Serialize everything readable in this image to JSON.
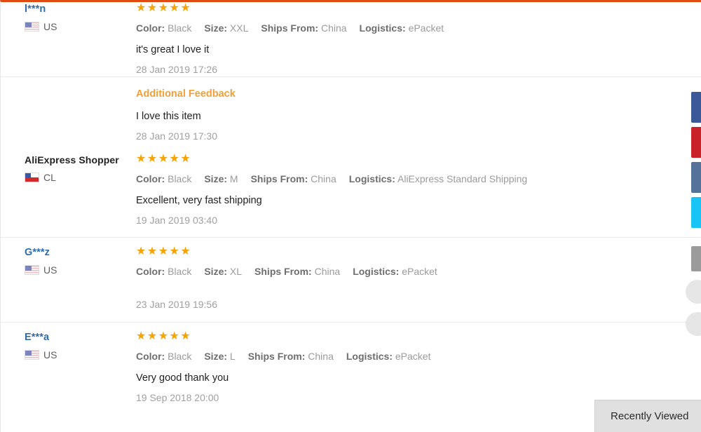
{
  "page": {
    "title": "AliExpress Product Feedback",
    "accent_color": "#e14b11",
    "star_color": "#f6a306",
    "link_color": "#2f6bb0",
    "muted_color": "#9b9b9b"
  },
  "labels": {
    "color_key": "Color:",
    "size_key": "Size:",
    "ships_from_key": "Ships From:",
    "logistics_key": "Logistics:",
    "additional_feedback": "Additional Feedback",
    "stars_full": "★★★★★"
  },
  "reviews": [
    {
      "reviewer": "l***n",
      "anonymous": false,
      "country_code": "US",
      "flag": "us-flag-icon",
      "rating": 5,
      "stars": "★★★★★",
      "color": "Black",
      "size": "XXL",
      "ships_from": "China",
      "logistics": "ePacket",
      "comment": "it's great I love it",
      "date": "28 Jan 2019 17:26",
      "additional_feedback": {
        "title": "Additional Feedback",
        "comment": "I love this item",
        "date": "28 Jan 2019 17:30"
      }
    },
    {
      "reviewer": "AliExpress Shopper",
      "anonymous": true,
      "country_code": "CL",
      "flag": "cl-flag-icon",
      "rating": 5,
      "stars": "★★★★★",
      "color": "Black",
      "size": "M",
      "ships_from": "China",
      "logistics": "AliExpress Standard Shipping",
      "comment": "Excellent, very fast shipping",
      "date": "19 Jan 2019 03:40",
      "additional_feedback": null
    },
    {
      "reviewer": "G***z",
      "anonymous": false,
      "country_code": "US",
      "flag": "us-flag-icon",
      "rating": 5,
      "stars": "★★★★★",
      "color": "Black",
      "size": "XL",
      "ships_from": "China",
      "logistics": "ePacket",
      "comment": "",
      "date": "23 Jan 2019 19:56",
      "additional_feedback": null
    },
    {
      "reviewer": "E***a",
      "anonymous": false,
      "country_code": "US",
      "flag": "us-flag-icon",
      "rating": 5,
      "stars": "★★★★★",
      "color": "Black",
      "size": "L",
      "ships_from": "China",
      "logistics": "ePacket",
      "comment": "Very good thank you",
      "date": "19 Sep 2018 20:00",
      "additional_feedback": null
    }
  ],
  "share_bar": [
    {
      "name": "facebook-share-icon",
      "color": "#3b5998"
    },
    {
      "name": "pinterest-share-icon",
      "color": "#c92228"
    },
    {
      "name": "vk-share-icon",
      "color": "#55729b"
    },
    {
      "name": "twitter-share-icon",
      "color": "#18c3f5"
    },
    {
      "name": "more-share-icon",
      "color": "#9b9b9b"
    }
  ],
  "scroll_controls": [
    {
      "name": "scroll-up-button"
    },
    {
      "name": "scroll-down-button"
    }
  ],
  "recently_viewed": {
    "label": "Recently Viewed"
  }
}
